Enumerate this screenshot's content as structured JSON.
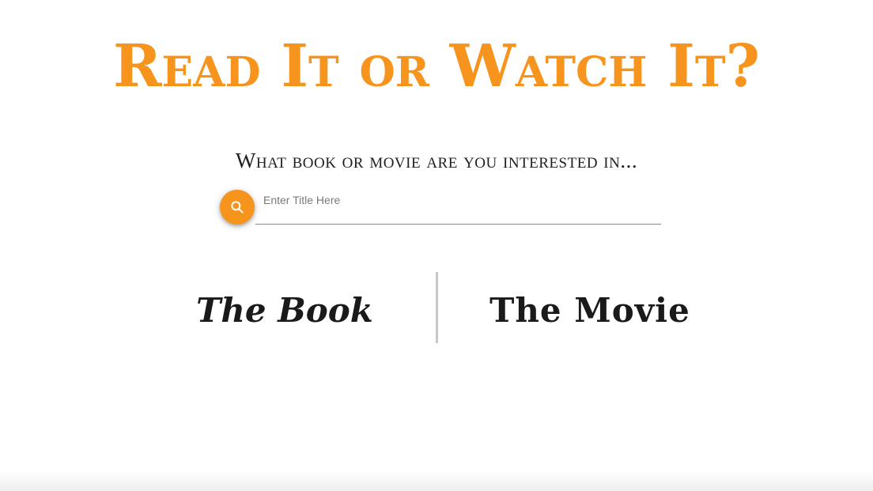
{
  "header": {
    "title": "Read It or Watch It?"
  },
  "search": {
    "prompt": "What book or movie are you interested in...",
    "placeholder": "Enter Title Here",
    "value": "",
    "button_icon": "search-icon"
  },
  "columns": {
    "book_heading": "The Book",
    "movie_heading": "The Movie"
  },
  "colors": {
    "accent": "#f7941d",
    "text": "#1a1a1a",
    "divider": "#c8c8c8"
  }
}
